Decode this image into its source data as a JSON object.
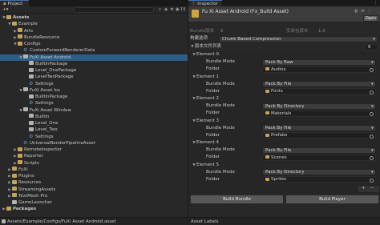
{
  "project": {
    "tab": "Project",
    "badge": "19",
    "tree": [
      {
        "label": "Assets",
        "depth": 0,
        "icon": "folder",
        "open": true,
        "bold": true
      },
      {
        "label": "Example",
        "depth": 1,
        "icon": "folder",
        "open": true
      },
      {
        "label": "Arts",
        "depth": 2,
        "icon": "folder",
        "open": false
      },
      {
        "label": "BundleResource",
        "depth": 2,
        "icon": "folder",
        "open": false
      },
      {
        "label": "Configs",
        "depth": 2,
        "icon": "folder",
        "open": true
      },
      {
        "label": "CustomForwardRendererData",
        "depth": 3,
        "icon": "gear"
      },
      {
        "label": "FuXi Asset Android",
        "depth": 3,
        "icon": "asset",
        "open": true,
        "selected": true
      },
      {
        "label": "BuiltinPackage",
        "depth": 4,
        "icon": "asset"
      },
      {
        "label": "Level_OnePackage",
        "depth": 4,
        "icon": "asset"
      },
      {
        "label": "LevelTwoPackage",
        "depth": 4,
        "icon": "asset"
      },
      {
        "label": "Settings",
        "depth": 4,
        "icon": "gear"
      },
      {
        "label": "FuXi Asset Ios",
        "depth": 3,
        "icon": "asset",
        "open": true
      },
      {
        "label": "BuiltinPackage",
        "depth": 4,
        "icon": "asset"
      },
      {
        "label": "Settings",
        "depth": 4,
        "icon": "gear"
      },
      {
        "label": "FuXi Asset Window",
        "depth": 3,
        "icon": "asset",
        "open": true
      },
      {
        "label": "Builtin",
        "depth": 4,
        "icon": "asset"
      },
      {
        "label": "Level_One",
        "depth": 4,
        "icon": "asset"
      },
      {
        "label": "Level_Two",
        "depth": 4,
        "icon": "asset"
      },
      {
        "label": "Settings",
        "depth": 4,
        "icon": "gear"
      },
      {
        "label": "UniversalRenderPipelineAsset",
        "depth": 3,
        "icon": "gear"
      },
      {
        "label": "RemoteInspector",
        "depth": 2,
        "icon": "folder",
        "open": false
      },
      {
        "label": "Reporter",
        "depth": 2,
        "icon": "folder",
        "open": false
      },
      {
        "label": "Scripts",
        "depth": 2,
        "icon": "folder",
        "open": false
      },
      {
        "label": "FuXi",
        "depth": 1,
        "icon": "folder",
        "open": false
      },
      {
        "label": "Plugins",
        "depth": 1,
        "icon": "folder",
        "open": false
      },
      {
        "label": "Resources",
        "depth": 1,
        "icon": "folder",
        "open": false
      },
      {
        "label": "StreamingAssets",
        "depth": 1,
        "icon": "folder",
        "open": false
      },
      {
        "label": "TextMesh Pro",
        "depth": 1,
        "icon": "folder",
        "open": false
      },
      {
        "label": "GameLauncher",
        "depth": 1,
        "icon": "asset"
      },
      {
        "label": "Packages",
        "depth": 0,
        "icon": "folder",
        "open": false,
        "bold": true
      }
    ],
    "status_path": "Assets/Example/Configs/FuXi Asset Android.asset"
  },
  "inspector": {
    "tab": "Inspector",
    "title": "Fu Xi Asset Android (Fx_Build Asset)",
    "open_label": "Open",
    "bundle_version_label": "Bundle版本",
    "bundle_version_value": "5",
    "install_version_label": "安装包版本",
    "install_version_value": "1.0",
    "build_option_label": "构建选项",
    "build_option_value": "Chunk Based Compression",
    "list_label": "版本文件列表",
    "list_count": "6",
    "bundle_mode_label": "Bundle Mode",
    "folder_label": "Folder",
    "elements": [
      {
        "name": "Element 0",
        "mode": "Pack By Raw",
        "folder": "Audios"
      },
      {
        "name": "Element 1",
        "mode": "Pack By File",
        "folder": "Fonts"
      },
      {
        "name": "Element 2",
        "mode": "Pack By Directory",
        "folder": "Materials"
      },
      {
        "name": "Element 3",
        "mode": "Pack By File",
        "folder": "Prefabs"
      },
      {
        "name": "Element 4",
        "mode": "Pack By File",
        "folder": "Scenes"
      },
      {
        "name": "Element 5",
        "mode": "Pack By Directory",
        "folder": "Sprites"
      }
    ],
    "add": "+",
    "remove": "−",
    "build_bundle": "Build Bundle",
    "build_player": "Build Player",
    "asset_labels": "Asset Labels"
  }
}
